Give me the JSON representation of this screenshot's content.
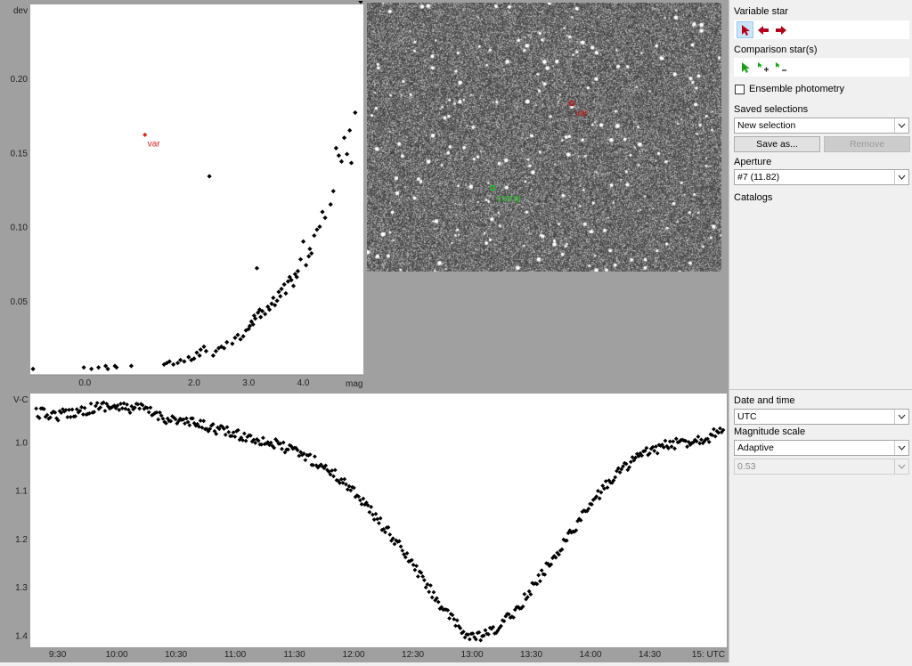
{
  "scatter_chart": {
    "chart_data": {
      "type": "scatter",
      "ylabel": "dev",
      "xlabel": "mag",
      "xticks": [
        "0.0",
        "2.0",
        "3.0",
        "4.0"
      ],
      "x_tick_values": [
        0.0,
        2.0,
        3.0,
        4.0
      ],
      "yticks": [
        "0.05",
        "0.10",
        "0.15",
        "0.20"
      ],
      "y_tick_values": [
        0.05,
        0.1,
        0.15,
        0.2
      ],
      "xlim": [
        -1.0,
        5.1
      ],
      "ylim": [
        0.0,
        0.25
      ],
      "highlight": {
        "name": "var",
        "x": 1.1,
        "y": 0.162,
        "color": "#dd2222"
      },
      "points": [
        [
          -0.95,
          0.004
        ],
        [
          -0.02,
          0.005
        ],
        [
          0.12,
          0.004
        ],
        [
          0.25,
          0.005
        ],
        [
          0.38,
          0.006
        ],
        [
          0.42,
          0.004
        ],
        [
          0.55,
          0.006
        ],
        [
          0.58,
          0.005
        ],
        [
          0.85,
          0.006
        ],
        [
          1.45,
          0.007
        ],
        [
          1.5,
          0.008
        ],
        [
          1.55,
          0.009
        ],
        [
          1.62,
          0.007
        ],
        [
          1.7,
          0.008
        ],
        [
          1.75,
          0.01
        ],
        [
          1.82,
          0.009
        ],
        [
          1.9,
          0.012
        ],
        [
          1.95,
          0.01
        ],
        [
          2.0,
          0.011
        ],
        [
          2.05,
          0.015
        ],
        [
          2.1,
          0.013
        ],
        [
          2.12,
          0.017
        ],
        [
          2.18,
          0.019
        ],
        [
          2.22,
          0.016
        ],
        [
          2.28,
          0.134
        ],
        [
          2.35,
          0.013
        ],
        [
          2.4,
          0.016
        ],
        [
          2.45,
          0.018
        ],
        [
          2.5,
          0.019
        ],
        [
          2.55,
          0.018
        ],
        [
          2.6,
          0.022
        ],
        [
          2.7,
          0.021
        ],
        [
          2.75,
          0.025
        ],
        [
          2.8,
          0.027
        ],
        [
          2.85,
          0.024
        ],
        [
          2.9,
          0.026
        ],
        [
          2.95,
          0.03
        ],
        [
          3.0,
          0.031
        ],
        [
          3.02,
          0.033
        ],
        [
          3.05,
          0.036
        ],
        [
          3.08,
          0.034
        ],
        [
          3.1,
          0.04
        ],
        [
          3.12,
          0.038
        ],
        [
          3.15,
          0.072
        ],
        [
          3.17,
          0.042
        ],
        [
          3.2,
          0.044
        ],
        [
          3.22,
          0.039
        ],
        [
          3.25,
          0.043
        ],
        [
          3.3,
          0.041
        ],
        [
          3.35,
          0.046
        ],
        [
          3.38,
          0.044
        ],
        [
          3.42,
          0.048
        ],
        [
          3.45,
          0.052
        ],
        [
          3.48,
          0.047
        ],
        [
          3.52,
          0.05
        ],
        [
          3.55,
          0.056
        ],
        [
          3.58,
          0.053
        ],
        [
          3.6,
          0.058
        ],
        [
          3.65,
          0.061
        ],
        [
          3.68,
          0.055
        ],
        [
          3.72,
          0.063
        ],
        [
          3.75,
          0.066
        ],
        [
          3.78,
          0.064
        ],
        [
          3.82,
          0.06
        ],
        [
          3.85,
          0.068
        ],
        [
          3.88,
          0.066
        ],
        [
          3.9,
          0.07
        ],
        [
          3.95,
          0.078
        ],
        [
          4.0,
          0.09
        ],
        [
          4.05,
          0.074
        ],
        [
          4.1,
          0.08
        ],
        [
          4.12,
          0.085
        ],
        [
          4.15,
          0.082
        ],
        [
          4.2,
          0.094
        ],
        [
          4.25,
          0.098
        ],
        [
          4.3,
          0.1
        ],
        [
          4.35,
          0.11
        ],
        [
          4.4,
          0.106
        ],
        [
          4.5,
          0.115
        ],
        [
          4.55,
          0.124
        ],
        [
          4.6,
          0.153
        ],
        [
          4.65,
          0.148
        ],
        [
          4.7,
          0.144
        ],
        [
          4.75,
          0.16
        ],
        [
          4.8,
          0.149
        ],
        [
          4.85,
          0.165
        ],
        [
          4.88,
          0.143
        ],
        [
          4.95,
          0.177
        ],
        [
          5.05,
          0.252
        ]
      ]
    }
  },
  "star_image": {
    "var_label": "var",
    "comp_label": "comp",
    "var_color": "#cc1111",
    "comp_color": "#1fbf1f"
  },
  "light_curve": {
    "chart_data": {
      "type": "scatter",
      "ylabel": "V-C",
      "y_inverted": true,
      "xticks": [
        "9:30",
        "10:00",
        "10:30",
        "11:00",
        "11:30",
        "12:00",
        "12:30",
        "13:00",
        "13:30",
        "14:00",
        "14:30",
        "15: UTC"
      ],
      "x_tick_values": [
        9.5,
        10.0,
        10.5,
        11.0,
        11.5,
        12.0,
        12.5,
        13.0,
        13.5,
        14.0,
        14.5,
        15.0
      ],
      "yticks": [
        "1.0",
        "1.1",
        "1.2",
        "1.3",
        "1.4"
      ],
      "y_tick_values": [
        1.0,
        1.1,
        1.2,
        1.3,
        1.4
      ],
      "xlim": [
        9.27,
        15.15
      ],
      "ylim": [
        0.9,
        1.425
      ],
      "curve_knots": [
        [
          9.32,
          0.94
        ],
        [
          9.5,
          0.945
        ],
        [
          9.7,
          0.935
        ],
        [
          9.9,
          0.925
        ],
        [
          10.05,
          0.93
        ],
        [
          10.2,
          0.93
        ],
        [
          10.4,
          0.95
        ],
        [
          10.6,
          0.96
        ],
        [
          10.8,
          0.97
        ],
        [
          11.0,
          0.985
        ],
        [
          11.2,
          0.995
        ],
        [
          11.4,
          1.01
        ],
        [
          11.6,
          1.03
        ],
        [
          11.8,
          1.06
        ],
        [
          12.0,
          1.1
        ],
        [
          12.2,
          1.16
        ],
        [
          12.4,
          1.22
        ],
        [
          12.6,
          1.29
        ],
        [
          12.8,
          1.36
        ],
        [
          12.95,
          1.4
        ],
        [
          13.05,
          1.405
        ],
        [
          13.2,
          1.39
        ],
        [
          13.4,
          1.34
        ],
        [
          13.6,
          1.27
        ],
        [
          13.8,
          1.2
        ],
        [
          14.0,
          1.13
        ],
        [
          14.2,
          1.07
        ],
        [
          14.4,
          1.03
        ],
        [
          14.6,
          1.01
        ],
        [
          14.8,
          1.0
        ],
        [
          15.0,
          0.99
        ],
        [
          15.12,
          0.97
        ]
      ]
    }
  },
  "panel": {
    "variable_star_label": "Variable star",
    "comparison_star_label": "Comparison star(s)",
    "ensemble_label": "Ensemble photometry",
    "ensemble_checked": false,
    "saved_selections_label": "Saved selections",
    "saved_selection_value": "New selection",
    "save_as_label": "Save as...",
    "remove_label": "Remove",
    "aperture_label": "Aperture",
    "aperture_value": "#7 (11.82)",
    "catalogs_label": "Catalogs",
    "date_time_label": "Date and time",
    "date_time_value": "UTC",
    "mag_scale_label": "Magnitude scale",
    "mag_scale_value": "Adaptive",
    "mag_scale_number": "0.53",
    "icons": {
      "select": "cursor-select-icon",
      "var_prev": "arrow-left-icon",
      "var_next": "arrow-right-icon",
      "comp_select": "cursor-select-icon",
      "comp_add": "cursor-add-icon",
      "comp_remove": "cursor-remove-icon"
    }
  }
}
